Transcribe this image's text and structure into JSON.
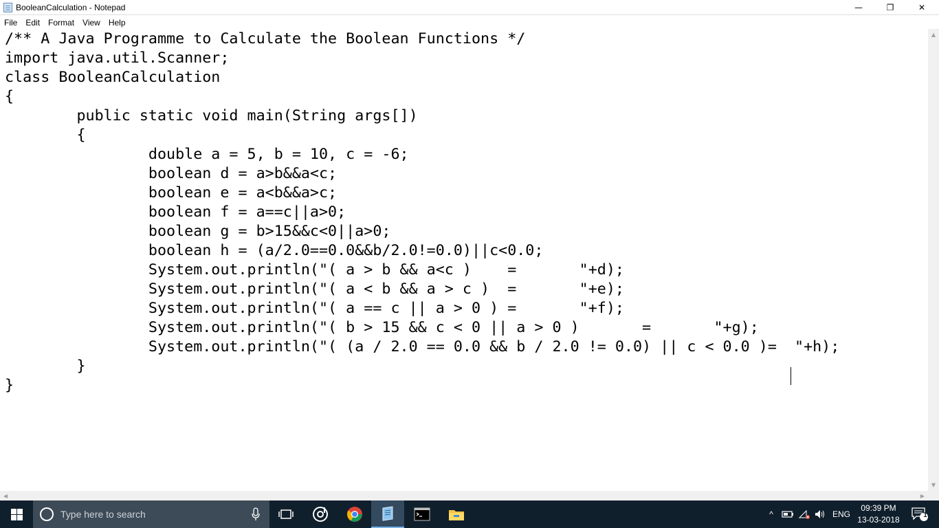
{
  "window": {
    "title": "BooleanCalculation - Notepad",
    "minimize_glyph": "—",
    "maximize_glyph": "❐",
    "close_glyph": "✕"
  },
  "menu": [
    "File",
    "Edit",
    "Format",
    "View",
    "Help"
  ],
  "editor": {
    "lines": [
      "/** A Java Programme to Calculate the Boolean Functions */",
      "import java.util.Scanner;",
      "class BooleanCalculation",
      "{",
      "        public static void main(String args[])",
      "        {",
      "                double a = 5, b = 10, c = -6;",
      "                boolean d = a>b&&a<c;",
      "                boolean e = a<b&&a>c;",
      "                boolean f = a==c||a>0;",
      "                boolean g = b>15&&c<0||a>0;",
      "                boolean h = (a/2.0==0.0&&b/2.0!=0.0)||c<0.0;",
      "                System.out.println(\"( a > b && a<c )    =       \"+d);",
      "                System.out.println(\"( a < b && a > c )  =       \"+e);",
      "                System.out.println(\"( a == c || a > 0 ) =       \"+f);",
      "                System.out.println(\"( b > 15 && c < 0 || a > 0 )       =       \"+g);",
      "                System.out.println(\"( (a / 2.0 == 0.0 && b / 2.0 != 0.0) || c < 0.0 )=  \"+h);",
      "        }",
      "}"
    ]
  },
  "taskbar": {
    "search_placeholder": "Type here to search",
    "tray_language": "ENG",
    "time": "09:39 PM",
    "date": "13-03-2018",
    "notification_count": "1"
  },
  "colors": {
    "taskbar": "#101f2c",
    "search_box": "#3d4a57",
    "active_indicator": "#77b3e8"
  }
}
